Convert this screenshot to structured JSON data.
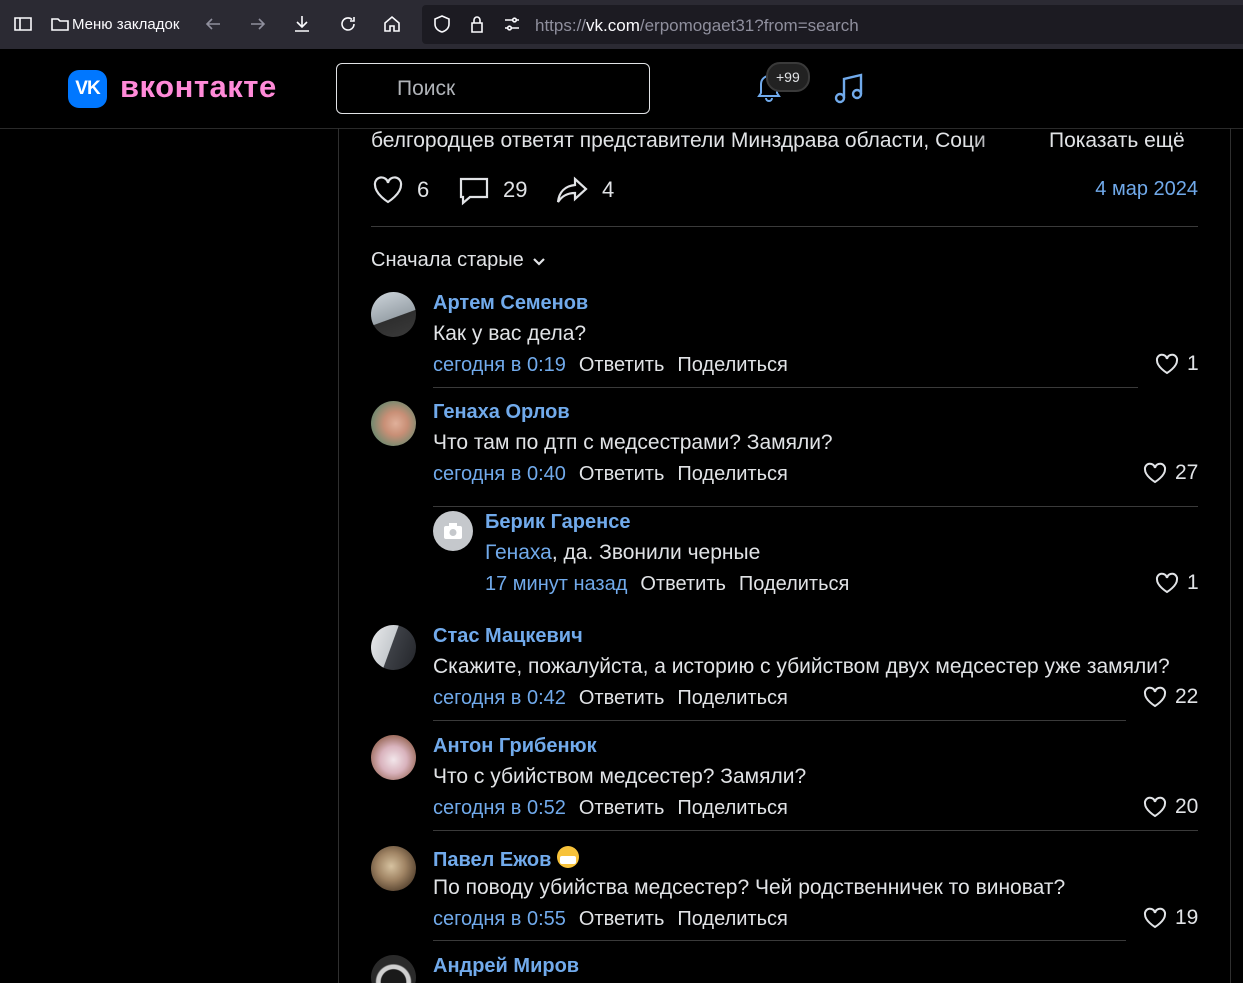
{
  "browser": {
    "bookmarks_label": "Меню закладок",
    "url_prefix": "https://",
    "url_host": "vk.com",
    "url_path": "/erpomogaet31?from=search"
  },
  "vk": {
    "logo_text": "VK",
    "wordmark": "вконтакте",
    "search_placeholder": "Поиск",
    "notifications_badge": "+99"
  },
  "post": {
    "text_visible": "белгородцев ответят представители Минздрава области, Соци",
    "show_more": "Показать ещё",
    "likes": "6",
    "comments": "29",
    "shares": "4",
    "date": "4 мар 2024",
    "sort_label": "Сначала старые"
  },
  "actions": {
    "reply": "Ответить",
    "share": "Поделиться"
  },
  "comments": [
    {
      "author": "Артем Семенов",
      "text": "Как у вас дела?",
      "date": "сегодня в 0:19",
      "likes": "1"
    },
    {
      "author": "Генаха Орлов",
      "text": "Что там по дтп с медсестрами? Замяли?",
      "date": "сегодня в 0:40",
      "likes": "27"
    },
    {
      "author": "Берик Гаренсе",
      "reply_to": "Генаха",
      "text": ", да. Звонили черные",
      "date": "17 минут назад",
      "likes": "1"
    },
    {
      "author": "Стас Мацкевич",
      "text": "Скажите, пожалуйста, а историю с убийством двух медсестер уже замяли?",
      "date": "сегодня в 0:42",
      "likes": "22"
    },
    {
      "author": "Антон Грибенюк",
      "text": "Что с убийством медсестер? Замяли?",
      "date": "сегодня в 0:52",
      "likes": "20"
    },
    {
      "author": "Павел Ежов",
      "text": "По поводу убийства медсестер? Чей родственничек то виноват?",
      "date": "сегодня в 0:55",
      "likes": "19"
    },
    {
      "author": "Андрей Миров"
    }
  ],
  "colors": {
    "accent_link": "#71aaeb",
    "vk_blue": "#0077ff",
    "wordmark": "#ff8ad8",
    "background": "#000000"
  }
}
